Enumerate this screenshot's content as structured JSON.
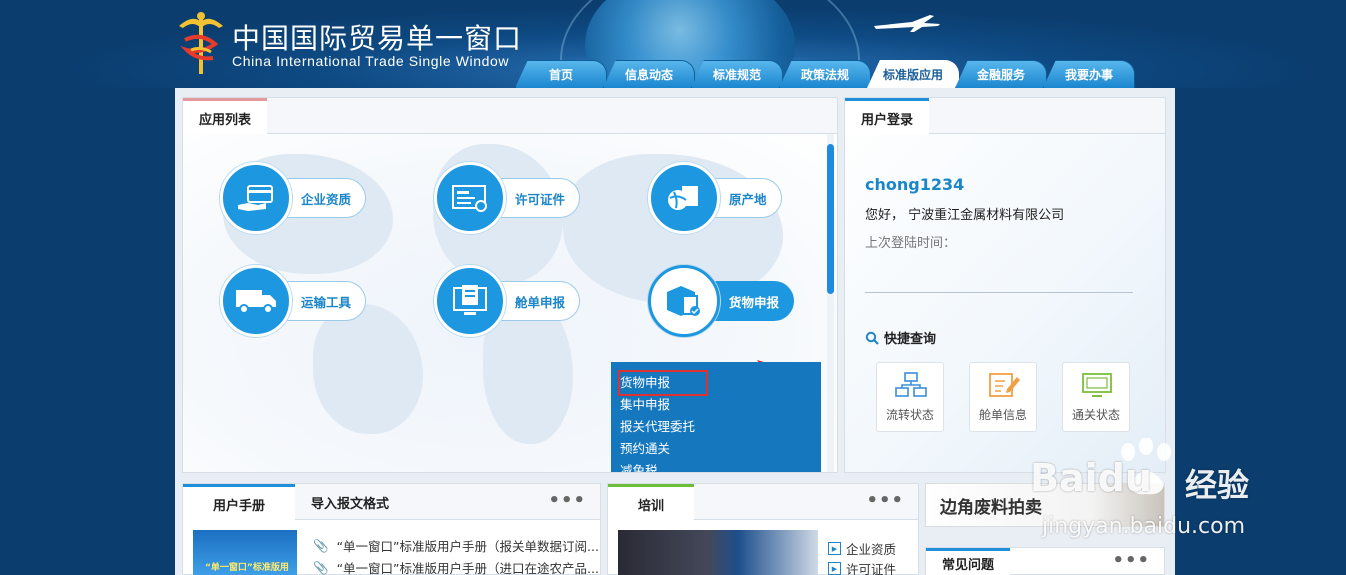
{
  "brand": {
    "title_cn": "中国国际贸易单一窗口",
    "title_en": "China International Trade Single  Window"
  },
  "nav": {
    "tabs": [
      {
        "label": "首页"
      },
      {
        "label": "信息动态"
      },
      {
        "label": "标准规范"
      },
      {
        "label": "政策法规"
      },
      {
        "label": "标准版应用",
        "active": true
      },
      {
        "label": "金融服务"
      },
      {
        "label": "我要办事"
      }
    ]
  },
  "apps_panel": {
    "tab_label": "应用列表",
    "apps": [
      {
        "label": "企业资质",
        "icon": "card-hand-icon"
      },
      {
        "label": "许可证件",
        "icon": "certificate-icon"
      },
      {
        "label": "原产地",
        "icon": "globe-doc-icon"
      },
      {
        "label": "运输工具",
        "icon": "truck-icon"
      },
      {
        "label": "舱单申报",
        "icon": "monitor-doc-icon"
      },
      {
        "label": "货物申报",
        "icon": "cargo-box-icon",
        "active": true
      }
    ],
    "dropdown": [
      {
        "label": "货物申报",
        "highlighted": true
      },
      {
        "label": "集中申报"
      },
      {
        "label": "报关代理委托"
      },
      {
        "label": "预约通关"
      },
      {
        "label": "减免税"
      }
    ]
  },
  "login_panel": {
    "tab_label": "用户登录",
    "username": "chong1234",
    "greeting": "您好， 宁波重江金属材料有限公司",
    "last_login_label": "上次登陆时间：",
    "quick_title": "快捷查询",
    "quick_links": [
      {
        "label": "流转状态",
        "icon": "network-icon"
      },
      {
        "label": "舱单信息",
        "icon": "edit-doc-icon"
      },
      {
        "label": "通关状态",
        "icon": "monitor-icon"
      }
    ]
  },
  "manual_panel": {
    "tabs": [
      "用户手册",
      "导入报文格式"
    ],
    "more": "•••",
    "thumb_text": "“单一窗口”标准版用户手册",
    "items": [
      "“单一窗口”标准版用户手册（报关单数据订阅...",
      "“单一窗口”标准版用户手册（进口在途农产品..."
    ]
  },
  "training_panel": {
    "tab_label": "培训",
    "more": "•••",
    "links": [
      "企业资质",
      "许可证件"
    ]
  },
  "banner": {
    "text": "边角废料拍卖"
  },
  "faq_panel": {
    "tab_label": "常见问题",
    "more": "•••"
  },
  "watermark": {
    "brand": "Baidu",
    "product": "经验",
    "url": "jingyan.baidu.com"
  }
}
